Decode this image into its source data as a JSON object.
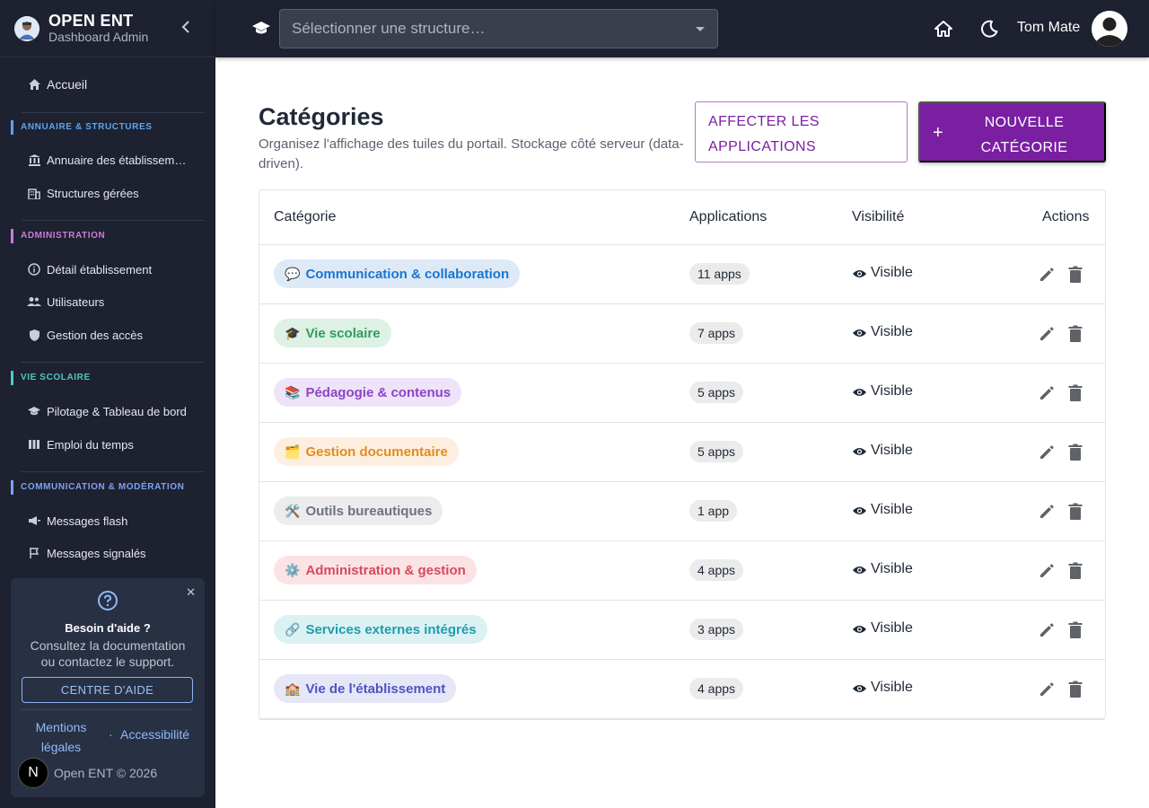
{
  "sidebar": {
    "brand_title": "OPEN ENT",
    "brand_subtitle": "Dashboard Admin",
    "home": "Accueil",
    "sections": [
      {
        "title": "ANNUAIRE & STRUCTURES",
        "color": "#5aa5f0",
        "items": [
          "Annuaire des établissem…",
          "Structures gérées"
        ]
      },
      {
        "title": "ADMINISTRATION",
        "color": "#d07ad8",
        "items": [
          "Détail établissement",
          "Utilisateurs",
          "Gestion des accès"
        ]
      },
      {
        "title": "VIE SCOLAIRE",
        "color": "#52c7c0",
        "items": [
          "Pilotage & Tableau de bord",
          "Emploi du temps"
        ]
      },
      {
        "title": "COMMUNICATION & MODÉRATION",
        "color": "#7ea2f0",
        "items": [
          "Messages flash",
          "Messages signalés"
        ]
      }
    ],
    "help": {
      "title": "Besoin d'aide ?",
      "text": "Consultez la documentation ou contactez le support.",
      "button": "CENTRE D'AIDE",
      "link_mentions": "Mentions légales",
      "separator": "·",
      "link_access": "Accessibilité",
      "badge": "N",
      "footer": "Open ENT © 2026"
    }
  },
  "topbar": {
    "structure_placeholder": "Sélectionner une structure…",
    "user_name": "Tom Mate"
  },
  "main": {
    "title": "Catégories",
    "description": "Organisez l'affichage des tuiles du portail. Stockage côté serveur (data-driven).",
    "btn_assign": "AFFECTER LES APPLICATIONS",
    "btn_new_plus": "+",
    "btn_new": "NOUVELLE CATÉGORIE"
  },
  "table": {
    "headers": {
      "category": "Catégorie",
      "applications": "Applications",
      "visibility": "Visibilité",
      "actions": "Actions"
    },
    "rows": [
      {
        "emoji": "💬",
        "name": "Communication & collaboration",
        "apps": "11 apps",
        "visibility": "Visible",
        "fg": "#1976d2",
        "bg": "#dde9f6"
      },
      {
        "emoji": "🎓",
        "name": "Vie scolaire",
        "apps": "7 apps",
        "visibility": "Visible",
        "fg": "#2e9e5b",
        "bg": "#ddf1e4"
      },
      {
        "emoji": "📚",
        "name": "Pédagogie & contenus",
        "apps": "5 apps",
        "visibility": "Visible",
        "fg": "#8e44c8",
        "bg": "#eee3f7"
      },
      {
        "emoji": "🗂️",
        "name": "Gestion documentaire",
        "apps": "5 apps",
        "visibility": "Visible",
        "fg": "#e68a1f",
        "bg": "#fcefdf"
      },
      {
        "emoji": "🛠️",
        "name": "Outils bureautiques",
        "apps": "1 app",
        "visibility": "Visible",
        "fg": "#6b7280",
        "bg": "#ececee"
      },
      {
        "emoji": "⚙️",
        "name": "Administration & gestion",
        "apps": "4 apps",
        "visibility": "Visible",
        "fg": "#d94a5a",
        "bg": "#fbe3e5"
      },
      {
        "emoji": "🔗",
        "name": "Services externes intégrés",
        "apps": "3 apps",
        "visibility": "Visible",
        "fg": "#1f9eae",
        "bg": "#dcf1f3"
      },
      {
        "emoji": "🏫",
        "name": "Vie de l'établissement",
        "apps": "4 apps",
        "visibility": "Visible",
        "fg": "#4a55c4",
        "bg": "#e5e7f7"
      }
    ]
  }
}
